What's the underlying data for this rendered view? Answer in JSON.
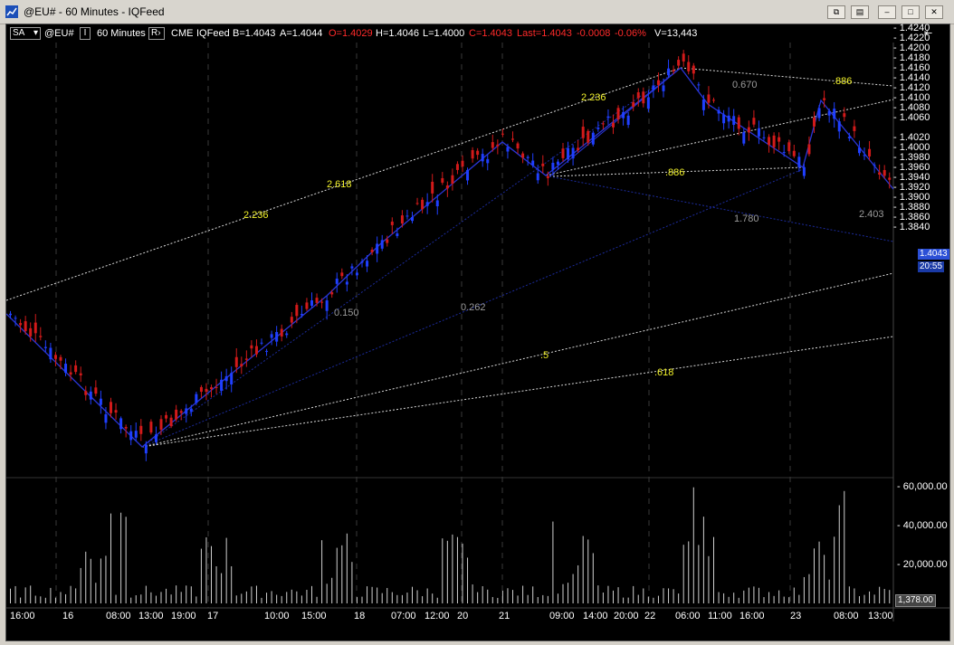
{
  "window": {
    "title": "@EU# - 60 Minutes - IQFeed",
    "controls": [
      "restore-down",
      "float",
      "minimize",
      "maximize",
      "close"
    ]
  },
  "toolbar": {
    "sa_label": "SA",
    "symbol": "@EU#",
    "interval_btn": "I",
    "interval": "60 Minutes",
    "r_btn": "R",
    "exchange": "CME",
    "feed": "IQFeed",
    "bid": "B=1.4043",
    "ask": "A=1.4044",
    "open": "O=1.4029",
    "high": "H=1.4046",
    "low": "L=1.4000",
    "close": "C=1.4043",
    "last": "Last=1.4043",
    "change": "-0.0008",
    "change_pct": "-0.06%",
    "volume": "V=13,443",
    "right_icon": "scroll-to-end-icon"
  },
  "colors": {
    "background": "#000000",
    "up_candle": "#1f3fff",
    "down_candle": "#d31a1a",
    "pattern_line": "#2a35d6",
    "fib_label": "#f2f22a",
    "fib_label_dim": "#9a9a9a",
    "price_badge": "#2244cc"
  },
  "chart": {
    "price_axis": [
      "1.4240",
      "1.4220",
      "1.4200",
      "1.4180",
      "1.4160",
      "1.4140",
      "1.4120",
      "1.4100",
      "1.4080",
      "1.4060",
      "1.4020",
      "1.4000",
      "1.3980",
      "1.3960",
      "1.3940",
      "1.3920",
      "1.3900",
      "1.3880",
      "1.3860",
      "1.3840"
    ],
    "last_price_badge": "1.4043",
    "countdown_badge": "20:55",
    "volume_axis": [
      "60,000.00",
      "40,000.00",
      "20,000.00"
    ],
    "volume_badge": "1,378.00",
    "time_axis": [
      "16:00",
      "16",
      "08:00",
      "13:00",
      "19:00",
      "17",
      "10:00",
      "15:00",
      "18",
      "07:00",
      "12:00",
      "20",
      "21",
      "09:00",
      "14:00",
      "20:00",
      "22",
      "06:00",
      "11:00",
      "16:00",
      "23",
      "08:00",
      "13:00"
    ],
    "fib_labels": [
      {
        "text": "2.236",
        "style": "yellow"
      },
      {
        "text": "2.618",
        "style": "yellow"
      },
      {
        "text": "2.236",
        "style": "yellow"
      },
      {
        "text": ".886",
        "style": "yellow"
      },
      {
        "text": ".886",
        "style": "yellow"
      },
      {
        "text": "0.670",
        "style": "gray"
      },
      {
        "text": "1.780",
        "style": "gray"
      },
      {
        "text": "2.403",
        "style": "gray"
      },
      {
        "text": "0.150",
        "style": "gray"
      },
      {
        "text": "0.262",
        "style": "gray"
      },
      {
        "text": ".5",
        "style": "yellow"
      },
      {
        "text": ".618",
        "style": "yellow"
      }
    ]
  }
}
